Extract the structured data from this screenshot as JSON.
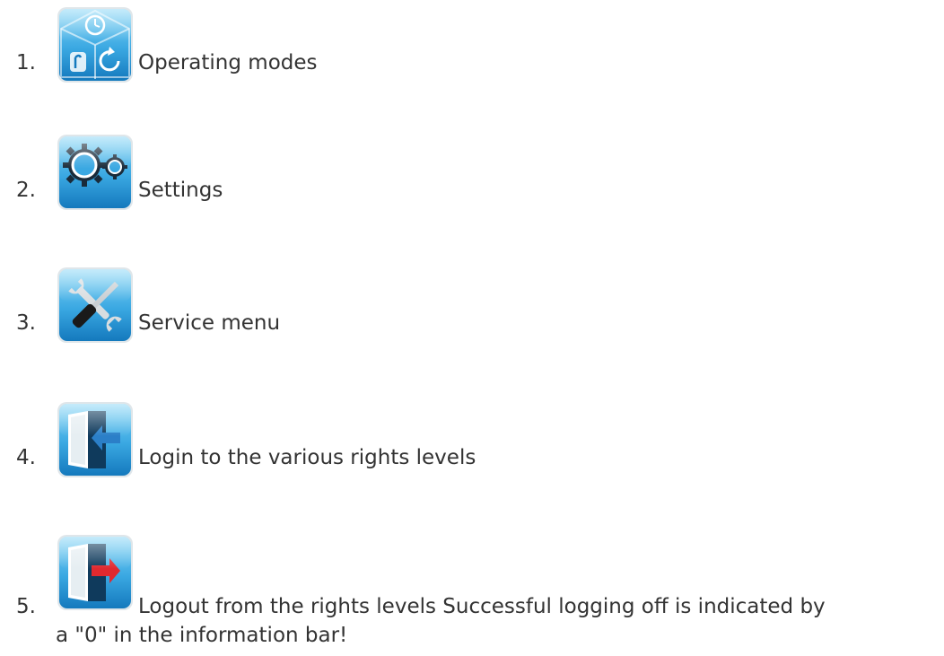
{
  "list": {
    "items": [
      {
        "number": "1.",
        "icon": "operating-modes-icon",
        "label": "Operating modes"
      },
      {
        "number": "2.",
        "icon": "gears-icon",
        "label": "Settings"
      },
      {
        "number": "3.",
        "icon": "wrench-screwdriver-icon",
        "label": "Service menu"
      },
      {
        "number": "4.",
        "icon": "door-login-icon",
        "label": "Login to the various rights levels"
      },
      {
        "number": "5.",
        "icon": "door-logout-icon",
        "label": "Logout from the rights levels Successful logging off is indicated by",
        "label_cont": "a \"0\" in the information bar!"
      }
    ]
  },
  "colors": {
    "icon_light": "#6ccaf2",
    "icon_dark": "#1787c8",
    "arrow_blue": "#2b7fc8",
    "arrow_red": "#e0292f"
  }
}
